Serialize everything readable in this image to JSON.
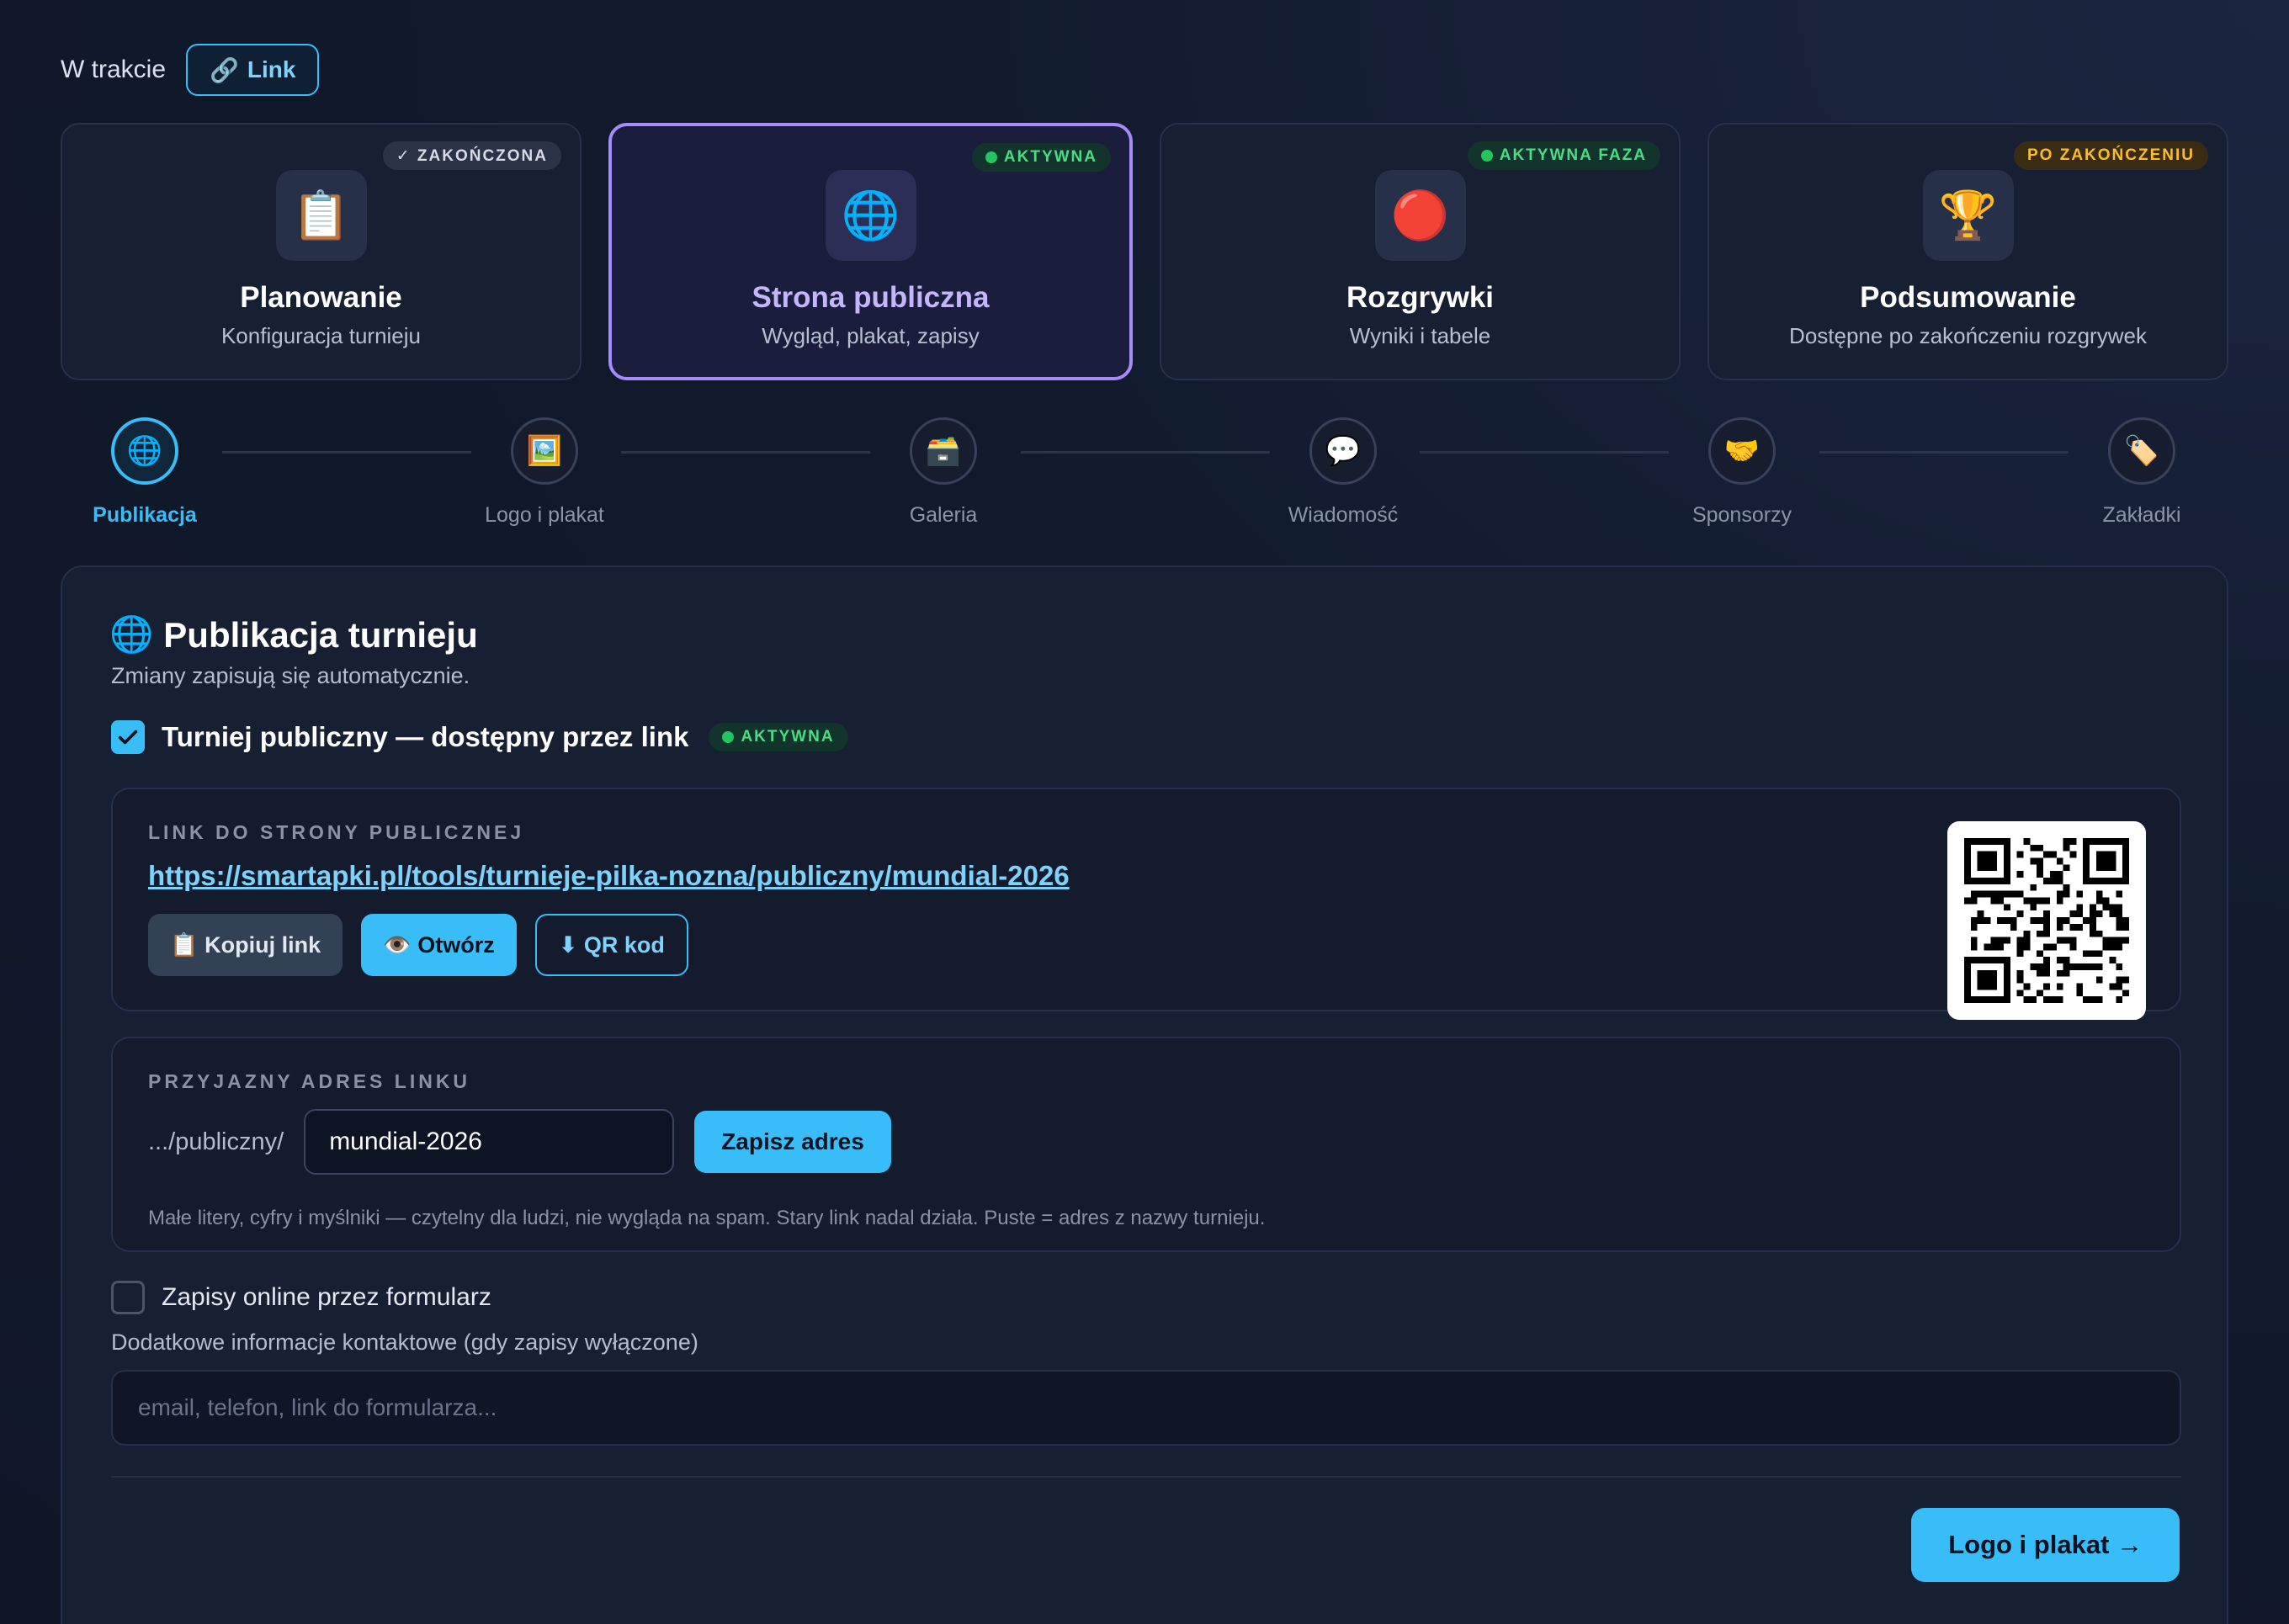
{
  "status": {
    "label": "W trakcie",
    "link_button": "Link"
  },
  "phases": [
    {
      "title": "Planowanie",
      "subtitle": "Konfiguracja turnieju",
      "badge": "✓ ZAKOŃCZONA",
      "icon": "📋"
    },
    {
      "title": "Strona publiczna",
      "subtitle": "Wygląd, plakat, zapisy",
      "badge": "AKTYWNA",
      "icon": "🌐"
    },
    {
      "title": "Rozgrywki",
      "subtitle": "Wyniki i tabele",
      "badge": "AKTYWNA FAZA",
      "icon": "🔴"
    },
    {
      "title": "Podsumowanie",
      "subtitle": "Dostępne po zakończeniu rozgrywek",
      "badge": "PO ZAKOŃCZENIU",
      "icon": "🏆"
    }
  ],
  "steps": [
    {
      "label": "Publikacja",
      "icon": "🌐"
    },
    {
      "label": "Logo i plakat",
      "icon": "🖼️"
    },
    {
      "label": "Galeria",
      "icon": "🗃️"
    },
    {
      "label": "Wiadomość",
      "icon": "💬"
    },
    {
      "label": "Sponsorzy",
      "icon": "🤝"
    },
    {
      "label": "Zakładki",
      "icon": "🏷️"
    }
  ],
  "panel": {
    "title_icon": "🌐",
    "title": "Publikacja turnieju",
    "subtitle": "Zmiany zapisują się automatycznie.",
    "public_label": "Turniej publiczny — dostępny przez link",
    "public_badge": "AKTYWNA",
    "link_card": {
      "label": "LINK DO STRONY PUBLICZNEJ",
      "url": "https://smartapki.pl/tools/turnieje-pilka-nozna/publiczny/mundial-2026",
      "copy": "📋 Kopiuj link",
      "open": "👁️ Otwórz",
      "qr": "⬇ QR kod"
    },
    "slug_card": {
      "label": "PRZYJAZNY ADRES LINKU",
      "prefix": ".../publiczny/",
      "value": "mundial-2026",
      "save": "Zapisz adres",
      "hint": "Małe litery, cyfry i myślniki — czytelny dla ludzi, nie wygląda na spam. Stary link nadal działa. Puste = adres z nazwy turnieju."
    },
    "registration_label": "Zapisy online przez formularz",
    "contact_label": "Dodatkowe informacje kontaktowe (gdy zapisy wyłączone)",
    "contact_placeholder": "email, telefon, link do formularza...",
    "next_button": "Logo i plakat →"
  },
  "colors": {
    "accent": "#38bdf8",
    "active_phase": "#a78bfa",
    "success": "#4ade80",
    "warning": "#fbbf24"
  }
}
